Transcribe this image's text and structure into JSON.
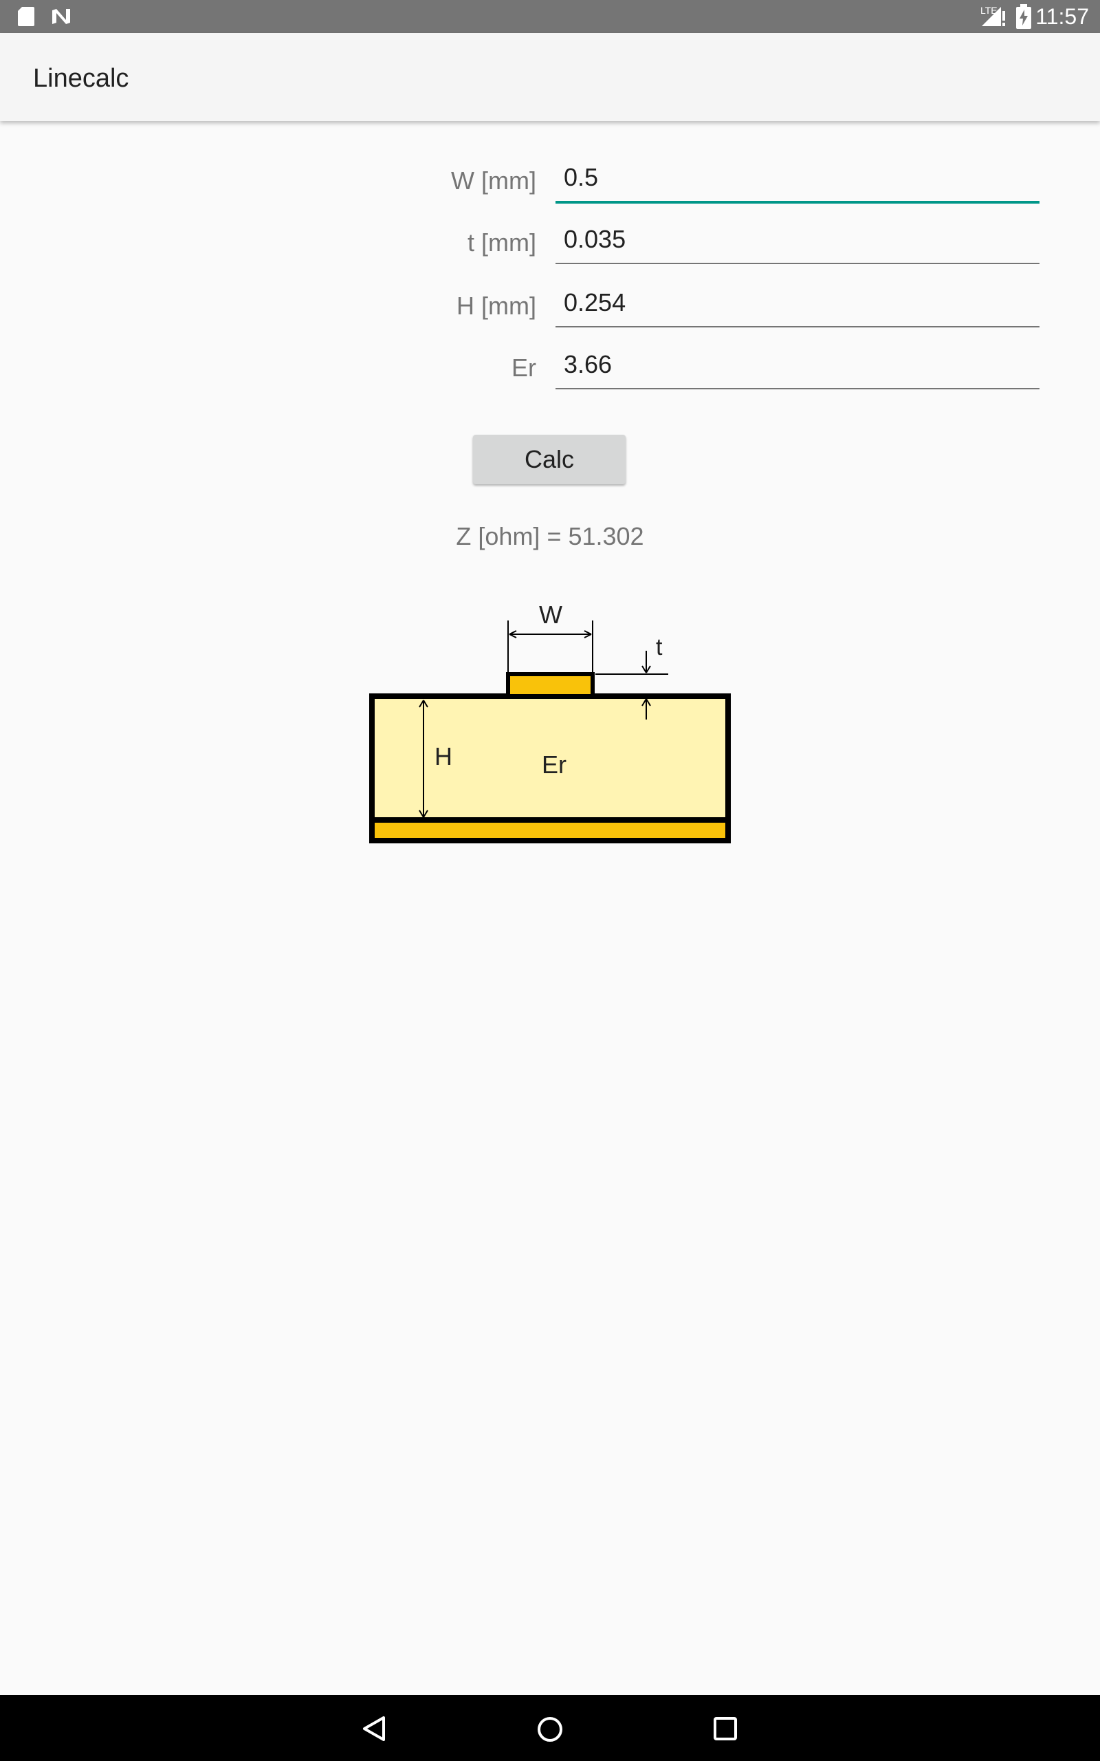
{
  "status_bar": {
    "time": "11:57",
    "network": "LTE",
    "icons": [
      "sd-card-icon",
      "n-notification-icon",
      "signal-icon",
      "battery-charging-icon"
    ]
  },
  "app_bar": {
    "title": "Linecalc"
  },
  "form": {
    "fields": [
      {
        "label": "W [mm]",
        "value": "0.5"
      },
      {
        "label": "t [mm]",
        "value": "0.035"
      },
      {
        "label": "H [mm]",
        "value": "0.254"
      },
      {
        "label": "Er",
        "value": "3.66"
      }
    ],
    "calc_label": "Calc"
  },
  "result": {
    "label": "Z [ohm]",
    "separator": " = ",
    "value": "51.302"
  },
  "diagram": {
    "width_label": "W",
    "thickness_label": "t",
    "height_label": "H",
    "permittivity_label": "Er"
  },
  "nav_bar": {
    "icons": [
      "back-icon",
      "home-icon",
      "recents-icon"
    ]
  },
  "colors": {
    "accent": "#009688",
    "substrate": "#FFF4B3",
    "copper": "#F9C20A",
    "status_bar": "#757575",
    "nav_bar": "#000000"
  }
}
